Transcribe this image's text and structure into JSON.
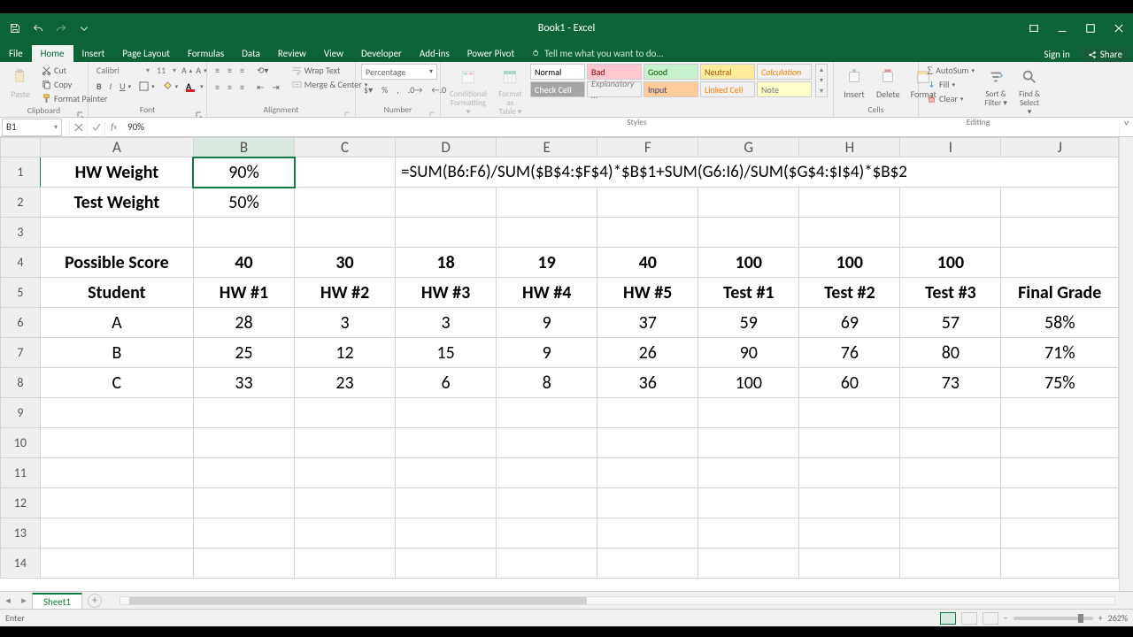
{
  "window": {
    "title": "Book1 - Excel",
    "signin": "Sign in",
    "share": "Share"
  },
  "tabs": {
    "file": "File",
    "home": "Home",
    "insert": "Insert",
    "pagelayout": "Page Layout",
    "formulas": "Formulas",
    "data": "Data",
    "review": "Review",
    "view": "View",
    "developer": "Developer",
    "addins": "Add-ins",
    "powerpivot": "Power Pivot",
    "tellme": "Tell me what you want to do..."
  },
  "ribbon": {
    "clipboard": {
      "label": "Clipboard",
      "paste": "Paste",
      "cut": "Cut",
      "copy": "Copy",
      "fmtpainter": "Format Painter"
    },
    "font": {
      "label": "Font",
      "name": "Calibri",
      "size": "11"
    },
    "alignment": {
      "label": "Alignment",
      "wrap": "Wrap Text",
      "merge": "Merge & Center"
    },
    "number": {
      "label": "Number",
      "format": "Percentage"
    },
    "styles": {
      "label": "Styles",
      "condfmt": "Conditional Formatting",
      "fmtastable": "Format as Table",
      "normal": "Normal",
      "bad": "Bad",
      "good": "Good",
      "neutral": "Neutral",
      "calculation": "Calculation",
      "checkcell": "Check Cell",
      "explanatory": "Explanatory ...",
      "input": "Input",
      "linkedcell": "Linked Cell",
      "note": "Note"
    },
    "cells": {
      "label": "Cells",
      "insert": "Insert",
      "delete": "Delete",
      "format": "Format"
    },
    "editing": {
      "label": "Editing",
      "autosum": "AutoSum",
      "fill": "Fill",
      "clear": "Clear",
      "sortfilter": "Sort & Filter",
      "findselect": "Find & Select"
    }
  },
  "namebox": "B1",
  "formulabar": "90%",
  "columns": [
    "A",
    "B",
    "C",
    "D",
    "E",
    "F",
    "G",
    "H",
    "I",
    "J"
  ],
  "rows_visible": 14,
  "cells": {
    "A1": "HW Weight",
    "B1": "90%",
    "A2": "Test Weight",
    "B2": "50%",
    "A4": "Possible Score",
    "B4": "40",
    "C4": "30",
    "D4": "18",
    "E4": "19",
    "F4": "40",
    "G4": "100",
    "H4": "100",
    "I4": "100",
    "A5": "Student",
    "B5": "HW #1",
    "C5": "HW #2",
    "D5": "HW #3",
    "E5": "HW #4",
    "F5": "HW #5",
    "G5": "Test #1",
    "H5": "Test #2",
    "I5": "Test #3",
    "J5": "Final Grade",
    "A6": "A",
    "B6": "28",
    "C6": "3",
    "D6": "3",
    "E6": "9",
    "F6": "37",
    "G6": "59",
    "H6": "69",
    "I6": "57",
    "J6": "58%",
    "A7": "B",
    "B7": "25",
    "C7": "12",
    "D7": "15",
    "E7": "9",
    "F7": "26",
    "G7": "90",
    "H7": "76",
    "I7": "80",
    "J7": "71%",
    "A8": "C",
    "B8": "33",
    "C8": "23",
    "D8": "6",
    "E8": "8",
    "F8": "36",
    "G8": "100",
    "H8": "60",
    "I8": "73",
    "J8": "75%"
  },
  "overlay_formula": "=SUM(B6:F6)/SUM($B$4:$F$4)*$B$1+SUM(G6:I6)/SUM($G$4:$I$4)*$B$2",
  "selected_cell": "B1",
  "sheettab": "Sheet1",
  "status": {
    "mode": "Enter",
    "zoom": "262%"
  }
}
